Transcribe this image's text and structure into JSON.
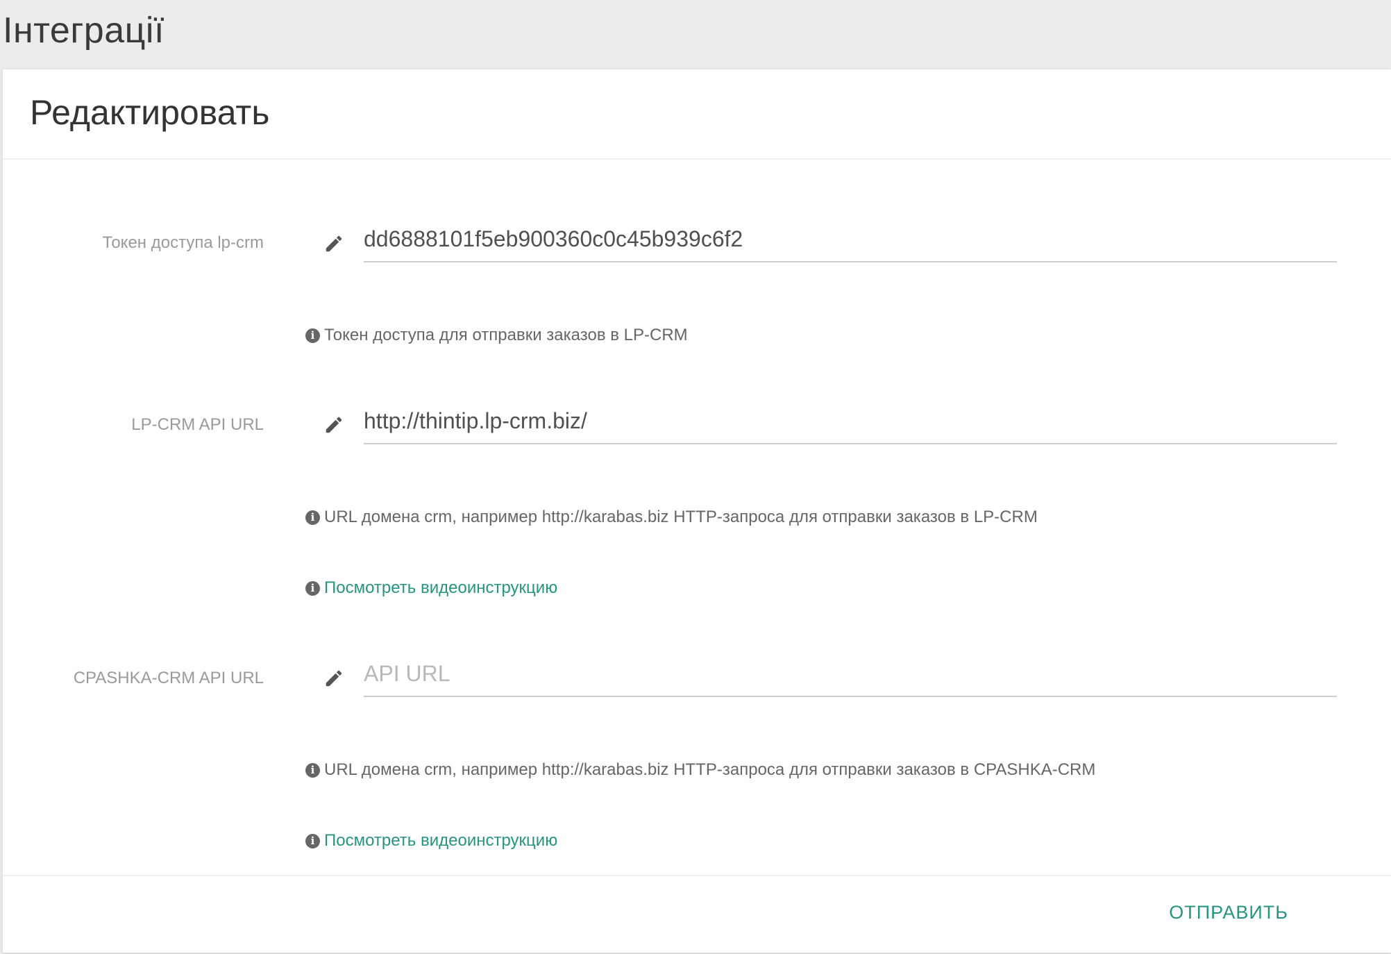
{
  "page": {
    "title": "Інтеграції"
  },
  "card": {
    "title": "Редактировать"
  },
  "fields": [
    {
      "label": "Токен доступа lp-crm",
      "value": "dd6888101f5eb900360c0c45b939c6f2",
      "placeholder": "",
      "help": "Токен доступа для отправки заказов в LP-CRM"
    },
    {
      "label": "LP-CRM API URL",
      "value": "http://thintip.lp-crm.biz/",
      "placeholder": "",
      "help": "URL домена crm, например http://karabas.biz HTTP-запроса для отправки заказов в LP-CRM",
      "video_link": "Посмотреть видеоинструкцию"
    },
    {
      "label": "CPASHKA-CRM API URL",
      "value": "",
      "placeholder": "API URL",
      "help": "URL домена crm, например http://karabas.biz HTTP-запроса для отправки заказов в CPASHKA-CRM",
      "video_link": "Посмотреть видеоинструкцию"
    }
  ],
  "icons": {
    "edit": "pencil-icon",
    "info": "info-circle-icon"
  },
  "footer": {
    "submit_label": "ОТПРАВИТЬ"
  },
  "colors": {
    "accent": "#26957f",
    "background": "#ececec",
    "card": "#ffffff",
    "muted_label": "#9a9a9a"
  }
}
